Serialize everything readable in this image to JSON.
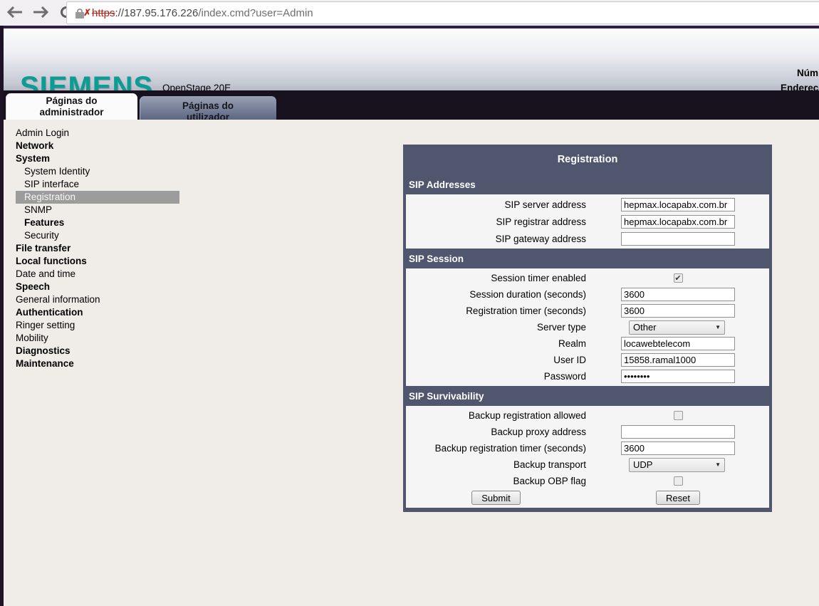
{
  "browser": {
    "url_scheme": "https",
    "url_host": "://187.95.176.226",
    "url_path": "/index.cmd?user=Admin",
    "lock_x": "✗"
  },
  "header": {
    "logo": "SIEMENS",
    "product": "OpenStage 20E",
    "right_line1": "Núm",
    "right_line2": "Endereço",
    "logo_color": "#0b9c94"
  },
  "tabs": [
    {
      "line1": "Páginas do",
      "line2": "administrador",
      "active": true
    },
    {
      "line1": "Páginas do",
      "line2": "utilizador",
      "active": false
    }
  ],
  "sidebar": {
    "items": [
      {
        "label": "Admin Login",
        "bold": false,
        "indent": false,
        "selected": false
      },
      {
        "label": "Network",
        "bold": true,
        "indent": false,
        "selected": false
      },
      {
        "label": "System",
        "bold": true,
        "indent": false,
        "selected": false
      },
      {
        "label": "System Identity",
        "bold": false,
        "indent": true,
        "selected": false
      },
      {
        "label": "SIP interface",
        "bold": false,
        "indent": true,
        "selected": false
      },
      {
        "label": "Registration",
        "bold": false,
        "indent": true,
        "selected": true
      },
      {
        "label": "SNMP",
        "bold": false,
        "indent": true,
        "selected": false
      },
      {
        "label": "Features",
        "bold": true,
        "indent": true,
        "selected": false
      },
      {
        "label": "Security",
        "bold": false,
        "indent": true,
        "selected": false
      },
      {
        "label": "File transfer",
        "bold": true,
        "indent": false,
        "selected": false
      },
      {
        "label": "Local functions",
        "bold": true,
        "indent": false,
        "selected": false
      },
      {
        "label": "Date and time",
        "bold": false,
        "indent": false,
        "selected": false
      },
      {
        "label": "Speech",
        "bold": true,
        "indent": false,
        "selected": false
      },
      {
        "label": "General information",
        "bold": false,
        "indent": false,
        "selected": false
      },
      {
        "label": "Authentication",
        "bold": true,
        "indent": false,
        "selected": false
      },
      {
        "label": "Ringer setting",
        "bold": false,
        "indent": false,
        "selected": false
      },
      {
        "label": "Mobility",
        "bold": false,
        "indent": false,
        "selected": false
      },
      {
        "label": "Diagnostics",
        "bold": true,
        "indent": false,
        "selected": false
      },
      {
        "label": "Maintenance",
        "bold": true,
        "indent": false,
        "selected": false
      }
    ]
  },
  "panel": {
    "title": "Registration",
    "accent_color": "#4f566e",
    "sections": [
      {
        "header": "SIP Addresses",
        "tall_rows": true,
        "rows": [
          {
            "label": "SIP server address",
            "type": "text",
            "value": "hepmax.locapabx.com.br"
          },
          {
            "label": "SIP registrar address",
            "type": "text",
            "value": "hepmax.locapabx.com.br"
          },
          {
            "label": "SIP gateway address",
            "type": "text",
            "value": ""
          }
        ]
      },
      {
        "header": "SIP Session",
        "tall_rows": false,
        "rows": [
          {
            "label": "Session timer enabled",
            "type": "checkbox",
            "checked": true
          },
          {
            "label": "Session duration (seconds)",
            "type": "text",
            "value": "3600"
          },
          {
            "label": "Registration timer (seconds)",
            "type": "text",
            "value": "3600"
          },
          {
            "label": "Server type",
            "type": "select",
            "value": "Other"
          },
          {
            "label": "Realm",
            "type": "text",
            "value": "locawebtelecom"
          },
          {
            "label": "User ID",
            "type": "text",
            "value": "15858.ramal1000"
          },
          {
            "label": "Password",
            "type": "password",
            "value": "••••••••"
          }
        ]
      },
      {
        "header": "SIP Survivability",
        "tall_rows": false,
        "rows": [
          {
            "label": "Backup registration allowed",
            "type": "checkbox",
            "checked": false
          },
          {
            "label": "Backup proxy address",
            "type": "text",
            "value": ""
          },
          {
            "label": "Backup registration timer (seconds)",
            "type": "text",
            "value": "3600"
          },
          {
            "label": "Backup transport",
            "type": "select",
            "value": "UDP"
          },
          {
            "label": "Backup OBP flag",
            "type": "checkbox",
            "checked": false
          }
        ]
      }
    ],
    "submit_label": "Submit",
    "reset_label": "Reset",
    "check_glyph": "✔",
    "select_arrow": "▼"
  }
}
